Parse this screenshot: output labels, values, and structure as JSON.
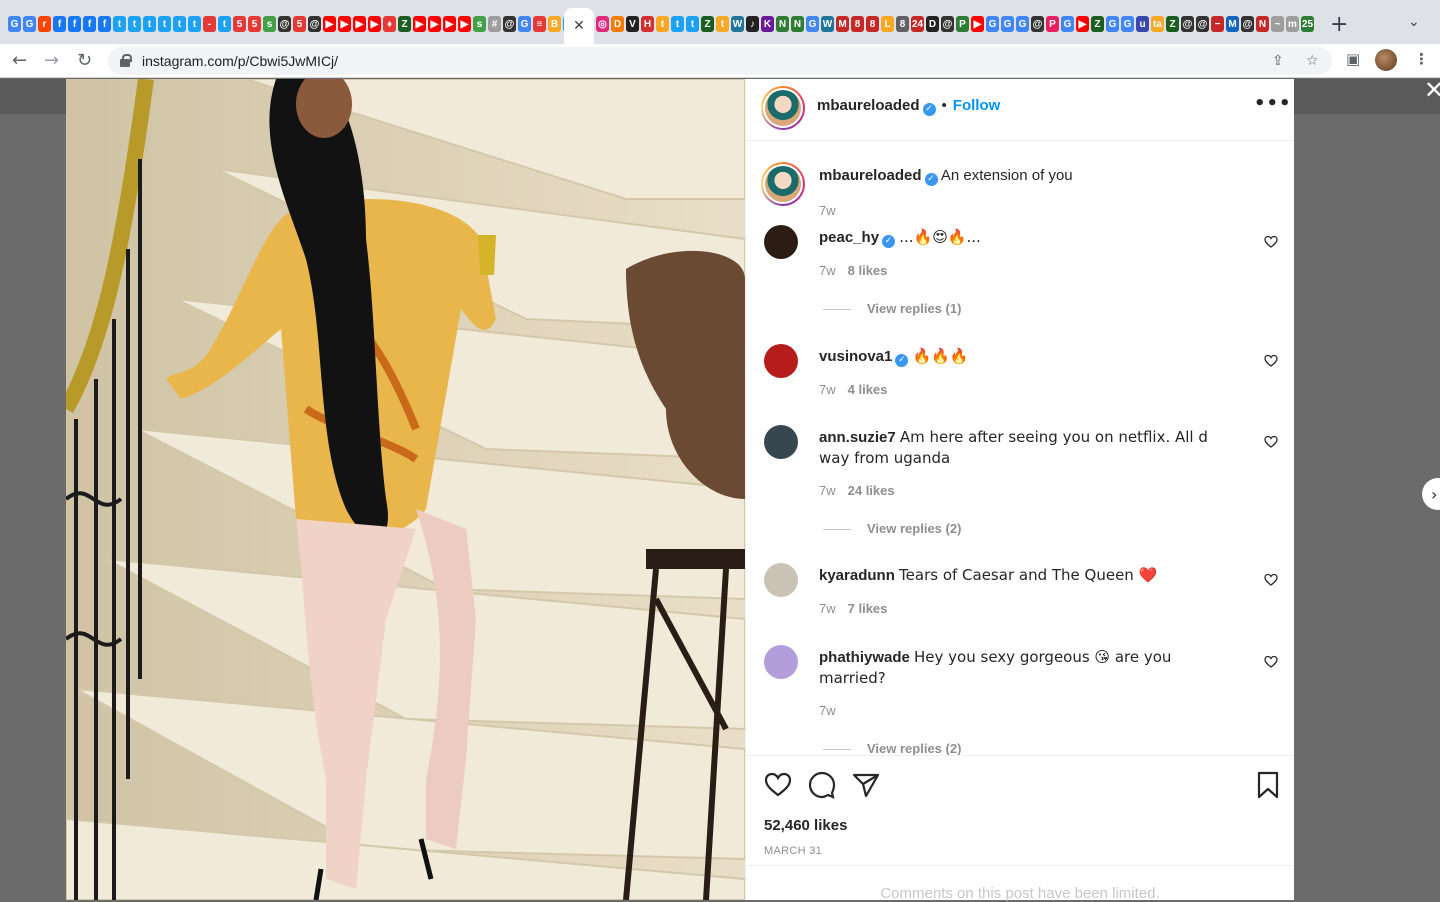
{
  "browser": {
    "url": "instagram.com/p/Cbwi5JwMICj/",
    "tab_favicons": [
      {
        "icon": "google-icon",
        "glyph": "G",
        "color": "#4285f4"
      },
      {
        "icon": "google-icon",
        "glyph": "G",
        "color": "#4285f4"
      },
      {
        "icon": "reddit-icon",
        "glyph": "r",
        "color": "#ff4500"
      },
      {
        "icon": "facebook-icon",
        "glyph": "f",
        "color": "#1877f2"
      },
      {
        "icon": "facebook-icon",
        "glyph": "f",
        "color": "#1877f2"
      },
      {
        "icon": "facebook-icon",
        "glyph": "f",
        "color": "#1877f2"
      },
      {
        "icon": "facebook-icon",
        "glyph": "f",
        "color": "#1877f2"
      },
      {
        "icon": "twitter-icon",
        "glyph": "t",
        "color": "#1da1f2"
      },
      {
        "icon": "twitter-icon",
        "glyph": "t",
        "color": "#1da1f2"
      },
      {
        "icon": "twitter-icon",
        "glyph": "t",
        "color": "#1da1f2"
      },
      {
        "icon": "twitter-icon",
        "glyph": "t",
        "color": "#1da1f2"
      },
      {
        "icon": "twitter-icon",
        "glyph": "t",
        "color": "#1da1f2"
      },
      {
        "icon": "twitter-icon",
        "glyph": "t",
        "color": "#1da1f2"
      },
      {
        "icon": "news-icon",
        "glyph": "-",
        "color": "#e53935"
      },
      {
        "icon": "twitter-icon",
        "glyph": "t",
        "color": "#1da1f2"
      },
      {
        "icon": "five-icon",
        "glyph": "5",
        "color": "#e53935"
      },
      {
        "icon": "five-icon",
        "glyph": "5",
        "color": "#e53935"
      },
      {
        "icon": "site-icon",
        "glyph": "s",
        "color": "#43a047"
      },
      {
        "icon": "threads-icon",
        "glyph": "@",
        "color": "#333333"
      },
      {
        "icon": "five-icon",
        "glyph": "5",
        "color": "#e53935"
      },
      {
        "icon": "threads-icon",
        "glyph": "@",
        "color": "#333333"
      },
      {
        "icon": "youtube-icon",
        "glyph": "▶",
        "color": "#ff0000"
      },
      {
        "icon": "youtube-icon",
        "glyph": "▶",
        "color": "#ff0000"
      },
      {
        "icon": "youtube-icon",
        "glyph": "▶",
        "color": "#ff0000"
      },
      {
        "icon": "youtube-icon",
        "glyph": "▶",
        "color": "#ff0000"
      },
      {
        "icon": "fire-icon",
        "glyph": "♦",
        "color": "#e53935"
      },
      {
        "icon": "site-icon",
        "glyph": "Z",
        "color": "#1b5e20"
      },
      {
        "icon": "youtube-icon",
        "glyph": "▶",
        "color": "#ff0000"
      },
      {
        "icon": "youtube-icon",
        "glyph": "▶",
        "color": "#ff0000"
      },
      {
        "icon": "youtube-icon",
        "glyph": "▶",
        "color": "#ff0000"
      },
      {
        "icon": "youtube-icon",
        "glyph": "▶",
        "color": "#ff0000"
      },
      {
        "icon": "site-icon",
        "glyph": "s",
        "color": "#43a047"
      },
      {
        "icon": "grid-icon",
        "glyph": "#",
        "color": "#9e9e9e"
      },
      {
        "icon": "threads-icon",
        "glyph": "@",
        "color": "#333333"
      },
      {
        "icon": "google-icon",
        "glyph": "G",
        "color": "#4285f4"
      },
      {
        "icon": "site-icon",
        "glyph": "≡",
        "color": "#e53935"
      },
      {
        "icon": "site-icon",
        "glyph": "B",
        "color": "#f9a825"
      },
      {
        "icon": "twitter-icon",
        "glyph": "t",
        "color": "#1da1f2"
      },
      {
        "icon": "instagram-icon",
        "glyph": "◎",
        "color": "#dd2a7b"
      },
      {
        "icon": "site-icon",
        "glyph": "D",
        "color": "#f57c00"
      },
      {
        "icon": "site-icon",
        "glyph": "V",
        "color": "#222222"
      },
      {
        "icon": "site-icon",
        "glyph": "H",
        "color": "#d32f2f"
      },
      {
        "icon": "site-icon",
        "glyph": "t",
        "color": "#f9a825"
      },
      {
        "icon": "twitter-icon",
        "glyph": "t",
        "color": "#1da1f2"
      },
      {
        "icon": "twitter-icon",
        "glyph": "t",
        "color": "#1da1f2"
      },
      {
        "icon": "site-icon",
        "glyph": "Z",
        "color": "#1b5e20"
      },
      {
        "icon": "site-icon",
        "glyph": "t",
        "color": "#f9a825"
      },
      {
        "icon": "wordpress-icon",
        "glyph": "W",
        "color": "#21759b"
      },
      {
        "icon": "site-icon",
        "glyph": "♪",
        "color": "#222222"
      },
      {
        "icon": "site-icon",
        "glyph": "K",
        "color": "#6a1b9a"
      },
      {
        "icon": "site-icon",
        "glyph": "N",
        "color": "#2e7d32"
      },
      {
        "icon": "site-icon",
        "glyph": "N",
        "color": "#2e7d32"
      },
      {
        "icon": "google-icon",
        "glyph": "G",
        "color": "#4285f4"
      },
      {
        "icon": "wordpress-icon",
        "glyph": "W",
        "color": "#21759b"
      },
      {
        "icon": "site-icon",
        "glyph": "M",
        "color": "#c62828"
      },
      {
        "icon": "site-icon",
        "glyph": "8",
        "color": "#c62828"
      },
      {
        "icon": "site-icon",
        "glyph": "8",
        "color": "#c62828"
      },
      {
        "icon": "site-icon",
        "glyph": "L",
        "color": "#f9a825"
      },
      {
        "icon": "site-icon",
        "glyph": "8",
        "color": "#616161"
      },
      {
        "icon": "site-icon",
        "glyph": "24",
        "color": "#c62828"
      },
      {
        "icon": "site-icon",
        "glyph": "D",
        "color": "#222222"
      },
      {
        "icon": "threads-icon",
        "glyph": "@",
        "color": "#333333"
      },
      {
        "icon": "site-icon",
        "glyph": "P",
        "color": "#2e7d32"
      },
      {
        "icon": "youtube-icon",
        "glyph": "▶",
        "color": "#ff0000"
      },
      {
        "icon": "google-icon",
        "glyph": "G",
        "color": "#4285f4"
      },
      {
        "icon": "google-icon",
        "glyph": "G",
        "color": "#4285f4"
      },
      {
        "icon": "google-icon",
        "glyph": "G",
        "color": "#4285f4"
      },
      {
        "icon": "threads-icon",
        "glyph": "@",
        "color": "#333333"
      },
      {
        "icon": "site-icon",
        "glyph": "P",
        "color": "#e91e63"
      },
      {
        "icon": "google-icon",
        "glyph": "G",
        "color": "#4285f4"
      },
      {
        "icon": "youtube-icon",
        "glyph": "▶",
        "color": "#ff0000"
      },
      {
        "icon": "site-icon",
        "glyph": "Z",
        "color": "#1b5e20"
      },
      {
        "icon": "google-icon",
        "glyph": "G",
        "color": "#4285f4"
      },
      {
        "icon": "google-icon",
        "glyph": "G",
        "color": "#4285f4"
      },
      {
        "icon": "site-icon",
        "glyph": "u",
        "color": "#3949ab"
      },
      {
        "icon": "site-icon",
        "glyph": "ta",
        "color": "#f9a825"
      },
      {
        "icon": "site-icon",
        "glyph": "Z",
        "color": "#1b5e20"
      },
      {
        "icon": "threads-icon",
        "glyph": "@",
        "color": "#333333"
      },
      {
        "icon": "threads-icon",
        "glyph": "@",
        "color": "#333333"
      },
      {
        "icon": "site-icon",
        "glyph": "−",
        "color": "#c62828"
      },
      {
        "icon": "site-icon",
        "glyph": "M",
        "color": "#1565c0"
      },
      {
        "icon": "threads-icon",
        "glyph": "@",
        "color": "#333333"
      },
      {
        "icon": "site-icon",
        "glyph": "N",
        "color": "#c62828"
      },
      {
        "icon": "site-icon",
        "glyph": "~",
        "color": "#9e9e9e"
      },
      {
        "icon": "site-icon",
        "glyph": "m",
        "color": "#9e9e9e"
      },
      {
        "icon": "site-icon",
        "glyph": "25",
        "color": "#2e7d32"
      }
    ],
    "favicons_after_active_start": 38
  },
  "post": {
    "author": "mbaureloaded",
    "follow_label": "Follow",
    "dot": "•",
    "more_label": "•••",
    "caption": "An extension of you",
    "caption_time": "7w",
    "likes_count": "52,460 likes",
    "date": "MARCH 31",
    "limited_notice": "Comments on this post have been limited."
  },
  "comments": [
    {
      "user": "peac_hy",
      "verified": true,
      "text": "...🔥😍🔥...",
      "time": "7w",
      "likes": "8 likes",
      "replies": "View replies (1)",
      "avatar_color": "#2b1d14"
    },
    {
      "user": "vusinova1",
      "verified": true,
      "text": "🔥🔥🔥",
      "time": "7w",
      "likes": "4 likes",
      "replies": "",
      "avatar_color": "#b71c1c"
    },
    {
      "user": "ann.suzie7",
      "verified": false,
      "text": "Am here after seeing you on netflix. All d way from uganda",
      "time": "7w",
      "likes": "24 likes",
      "replies": "View replies (2)",
      "avatar_color": "#37474f"
    },
    {
      "user": "kyaradunn",
      "verified": false,
      "text": "Tears of Caesar and The Queen ❤️",
      "time": "7w",
      "likes": "7 likes",
      "replies": "",
      "avatar_color": "#c9c2b5"
    },
    {
      "user": "phathiywade",
      "verified": false,
      "text": "Hey you sexy gorgeous 😘 are you married?",
      "time": "7w",
      "likes": "",
      "replies": "View replies (2)",
      "avatar_color": "#b39ddb"
    }
  ],
  "colors": {
    "follow_blue": "#0095f6",
    "verified_blue": "#3897f0",
    "meta_gray": "#8e8e8e",
    "text_dark": "#262626"
  }
}
